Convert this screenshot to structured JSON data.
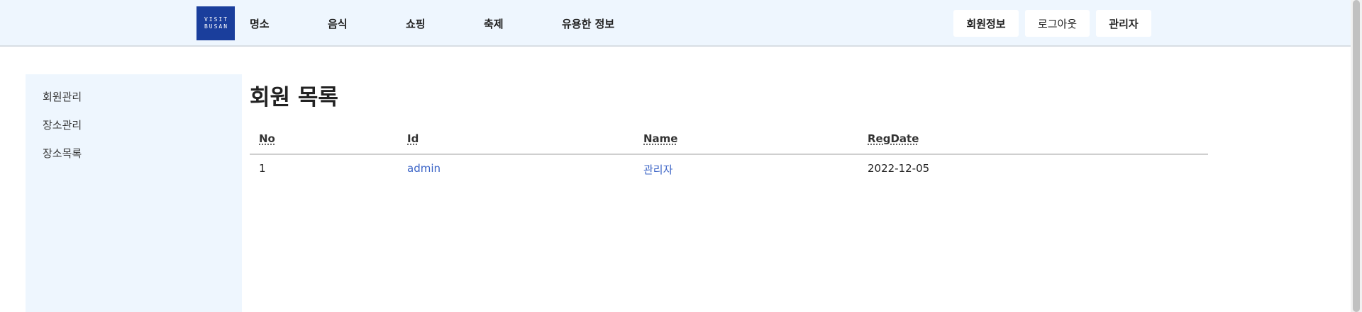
{
  "header": {
    "logo_lines": [
      "VISIT",
      "BUSAN"
    ],
    "nav": [
      "명소",
      "음식",
      "쇼핑",
      "축제",
      "유용한 정보"
    ],
    "buttons": [
      "회원정보",
      "로그아웃",
      "관리자"
    ]
  },
  "sidebar": {
    "items": [
      "회원관리",
      "장소관리",
      "장소목록"
    ]
  },
  "main": {
    "title": "회원 목록",
    "table": {
      "columns": [
        "No",
        "Id",
        "Name",
        "RegDate"
      ],
      "rows": [
        [
          "1",
          "admin",
          "관리자",
          "2022-12-05"
        ]
      ]
    }
  },
  "colors": {
    "header_bg": "#eef6fe",
    "logo_bg": "#1a3e9c",
    "link": "#3a63c6"
  }
}
